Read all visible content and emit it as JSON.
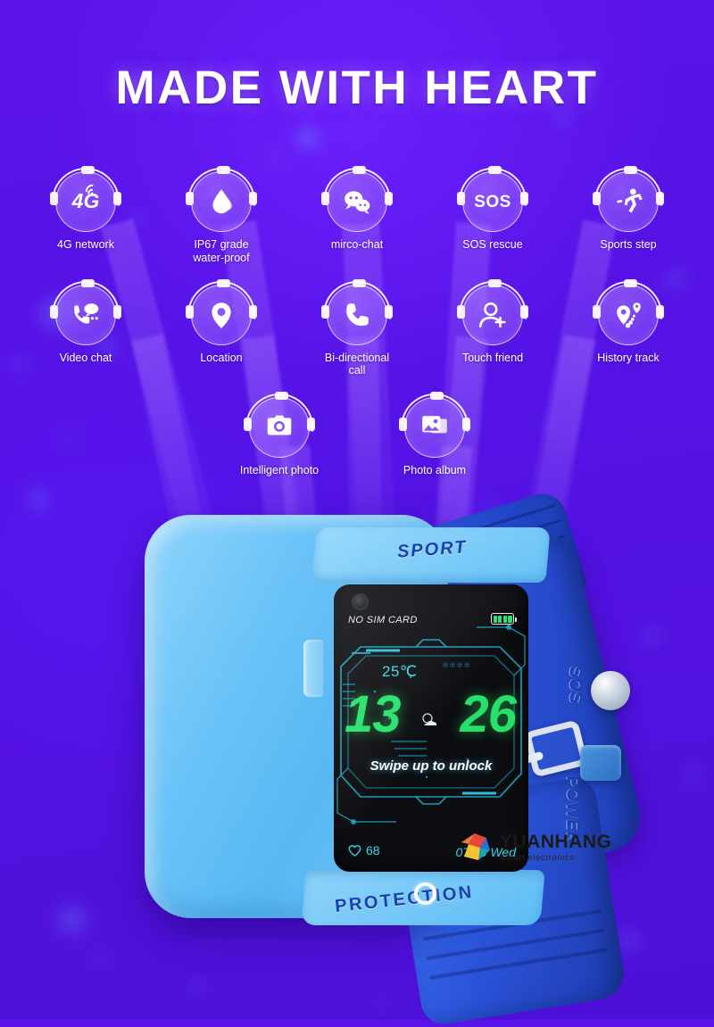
{
  "heading": {
    "title": "MADE WITH HEART"
  },
  "theme": {
    "background": "#5a13e8",
    "accent_green": "#27e06a",
    "accent_cyan": "#36d8e8",
    "case_blue": "#6cc4f8",
    "strap_blue": "#2a52d8",
    "emboss_navy": "#1b3fae"
  },
  "features": {
    "row1": [
      {
        "icon": "4g-network-icon",
        "label": "4G network",
        "glyph_text": "4G"
      },
      {
        "icon": "water-drop-icon",
        "label": "IP67 grade\nwater-proof",
        "glyph_text": ""
      },
      {
        "icon": "chat-bubbles-icon",
        "label": "mirco-chat",
        "glyph_text": ""
      },
      {
        "icon": "sos-icon",
        "label": "SOS  rescue",
        "glyph_text": "SOS"
      },
      {
        "icon": "running-person-icon",
        "label": "Sports step",
        "glyph_text": ""
      }
    ],
    "row2": [
      {
        "icon": "video-chat-icon",
        "label": "Video chat",
        "glyph_text": ""
      },
      {
        "icon": "location-pin-icon",
        "label": "Location",
        "glyph_text": ""
      },
      {
        "icon": "phone-handset-icon",
        "label": "Bi-directional\ncall",
        "glyph_text": ""
      },
      {
        "icon": "add-friend-icon",
        "label": "Touch friend",
        "glyph_text": ""
      },
      {
        "icon": "history-track-icon",
        "label": "History track",
        "glyph_text": ""
      }
    ],
    "row3": [
      {
        "icon": "camera-icon",
        "label": "Intelligent photo",
        "glyph_text": ""
      },
      {
        "icon": "photo-album-icon",
        "label": "Photo album",
        "glyph_text": ""
      }
    ]
  },
  "watch": {
    "emboss": {
      "top": "SPORT",
      "bottom": "PROTECTION",
      "side_upper": "SOS",
      "side_lower": "POWER"
    },
    "screen": {
      "sim_status": "NO SIM CARD",
      "battery_level": "full",
      "temperature": "25℃",
      "hours": "13",
      "minutes": "26",
      "unlock_hint": "Swipe up to unlock",
      "heart_rate": "68",
      "date": "07/10 Wed"
    }
  },
  "logo": {
    "name": "YUANHANG",
    "tagline": "Smart electronics"
  }
}
